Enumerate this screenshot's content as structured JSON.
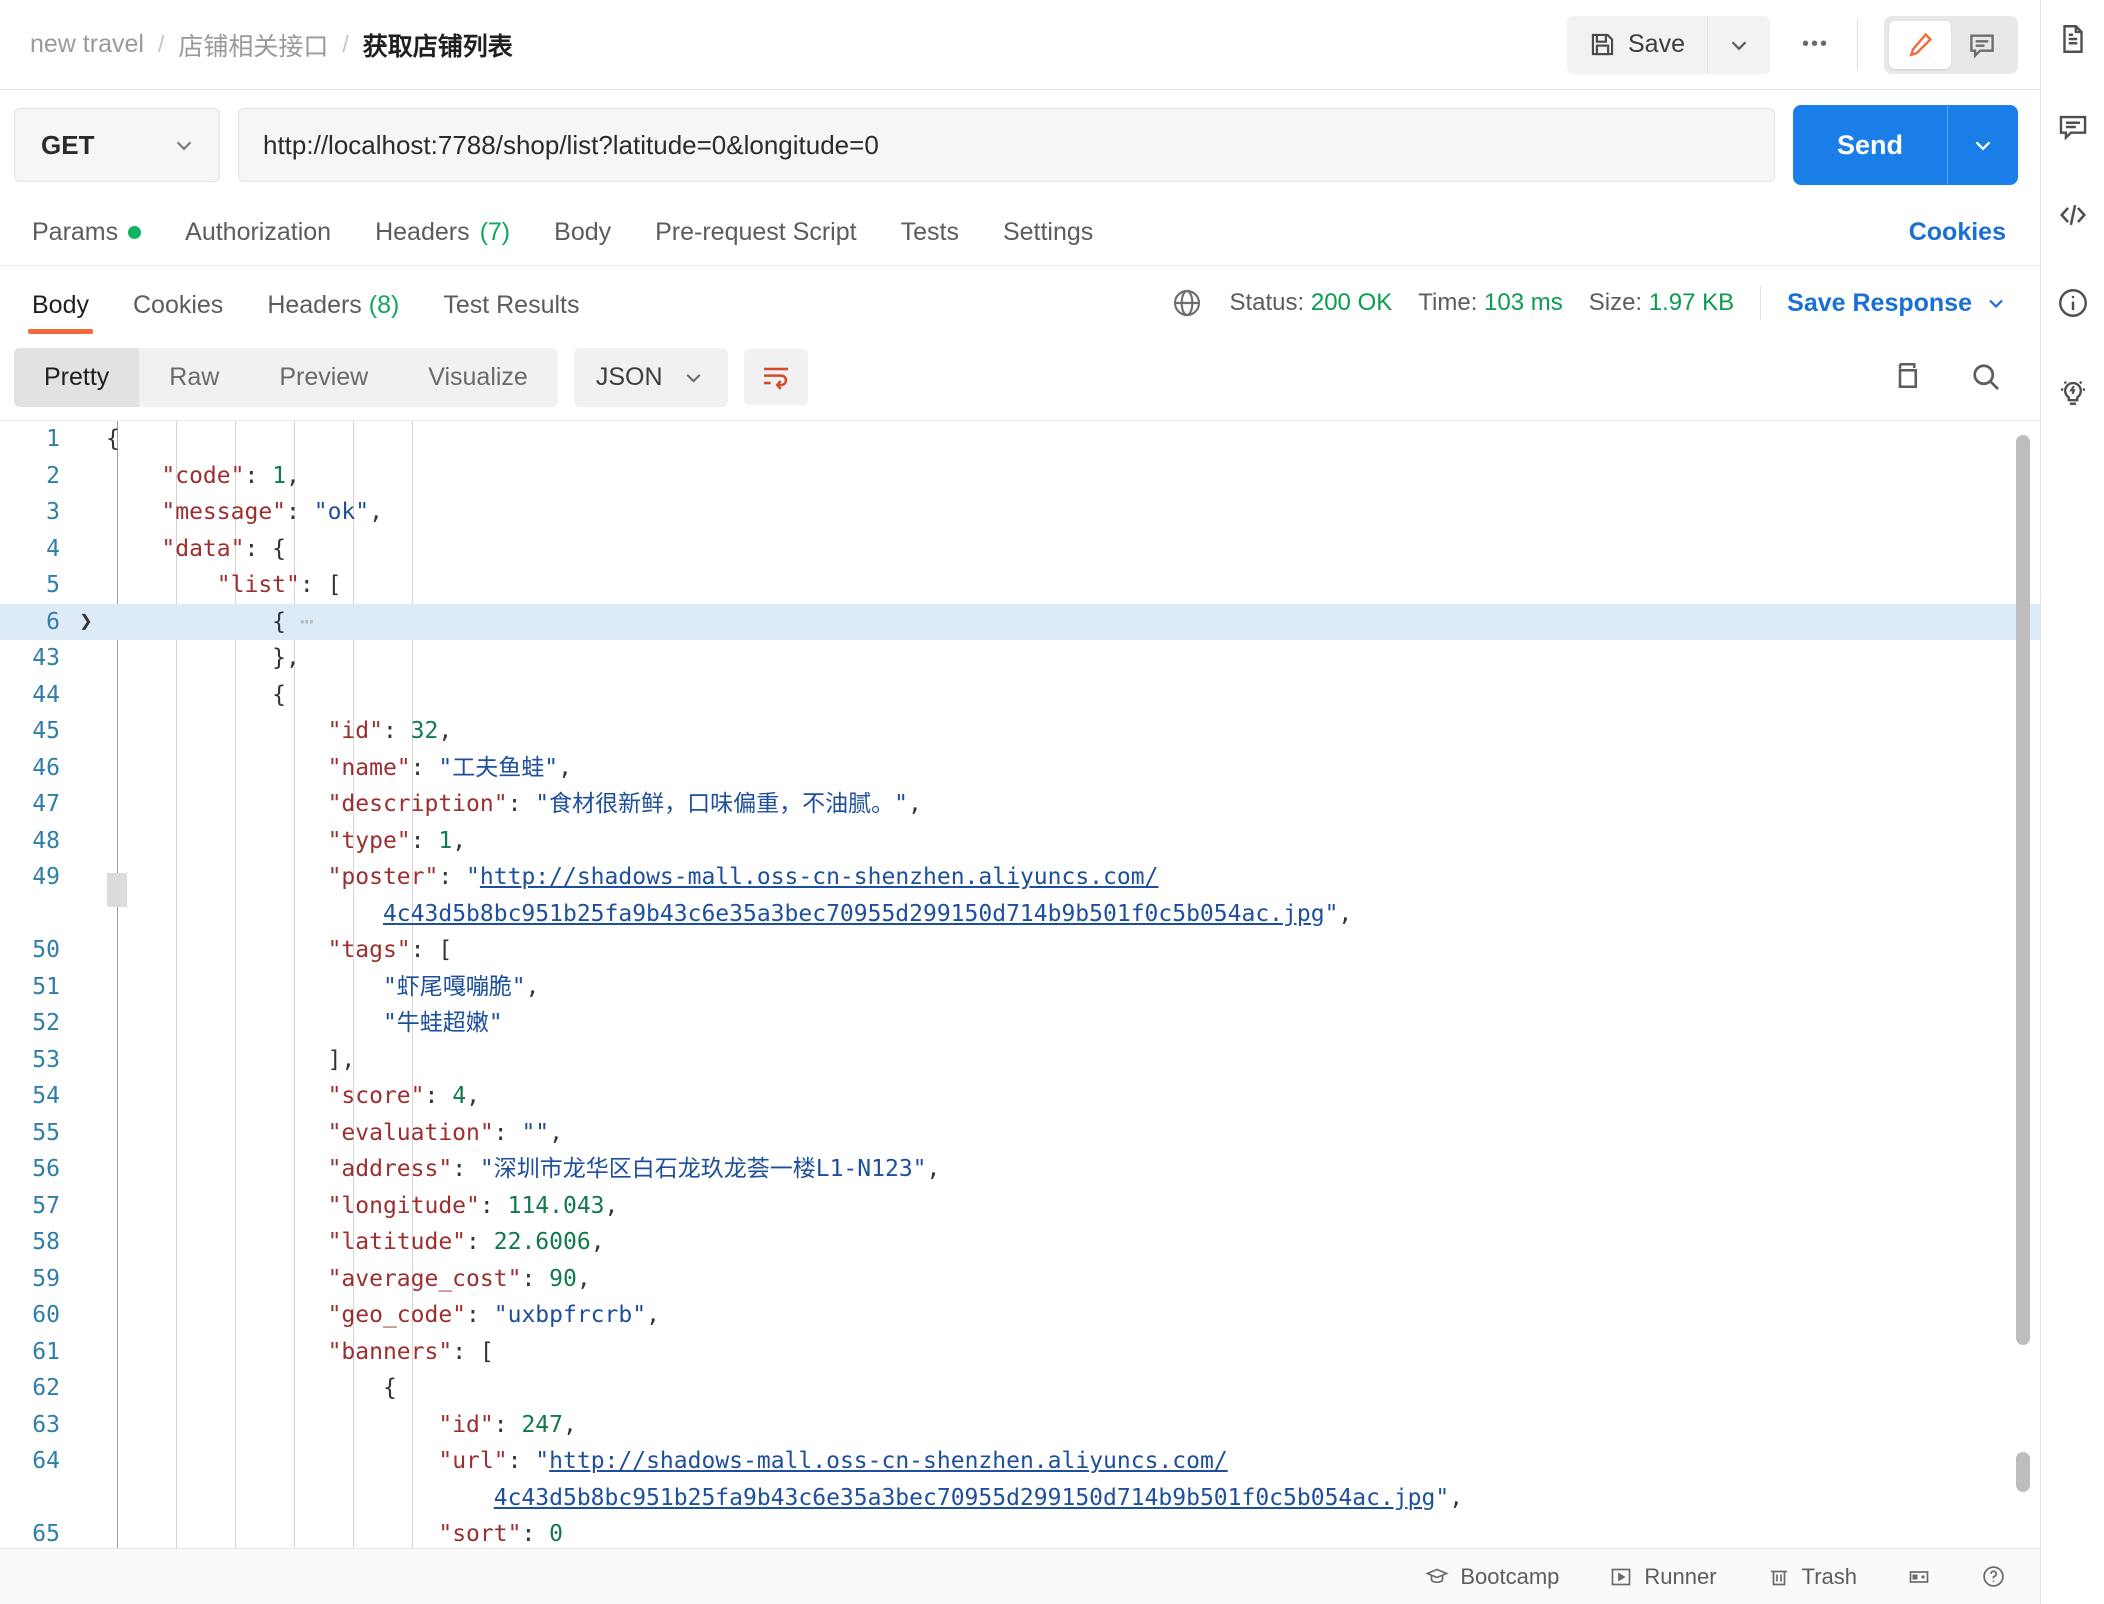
{
  "header": {
    "breadcrumb": [
      "new travel",
      "店铺相关接口",
      "获取店铺列表"
    ],
    "separator": "/",
    "save_label": "Save",
    "more_label": "•••",
    "icons": {
      "save": "floppy-disk-icon",
      "caret": "chevron-down-icon",
      "edit": "pencil-icon",
      "comment": "comment-icon"
    }
  },
  "request": {
    "method": "GET",
    "url": "http://localhost:7788/shop/list?latitude=0&longitude=0",
    "send_label": "Send",
    "tabs": [
      {
        "label": "Params",
        "badge": "",
        "dot": true
      },
      {
        "label": "Authorization",
        "badge": "",
        "dot": false
      },
      {
        "label": "Headers",
        "badge": "(7)",
        "dot": false
      },
      {
        "label": "Body",
        "badge": "",
        "dot": false
      },
      {
        "label": "Pre-request Script",
        "badge": "",
        "dot": false
      },
      {
        "label": "Tests",
        "badge": "",
        "dot": false
      },
      {
        "label": "Settings",
        "badge": "",
        "dot": false
      }
    ],
    "cookies_label": "Cookies"
  },
  "response": {
    "tabs": [
      {
        "label": "Body",
        "badge": "",
        "active": true
      },
      {
        "label": "Cookies",
        "badge": "",
        "active": false
      },
      {
        "label": "Headers",
        "badge": "(8)",
        "active": false
      },
      {
        "label": "Test Results",
        "badge": "",
        "active": false
      }
    ],
    "status_label": "Status:",
    "status_value": "200 OK",
    "time_label": "Time:",
    "time_value": "103 ms",
    "size_label": "Size:",
    "size_value": "1.97 KB",
    "save_response_label": "Save Response",
    "view_modes": [
      "Pretty",
      "Raw",
      "Preview",
      "Visualize"
    ],
    "active_view": "Pretty",
    "format": "JSON",
    "icons": {
      "globe": "globe-icon",
      "wrap": "word-wrap-icon",
      "copy": "copy-icon",
      "search": "search-icon"
    }
  },
  "code_lines": [
    {
      "num": "1",
      "indent": 0,
      "arrow": "",
      "tokens": [
        [
          "p",
          "{"
        ]
      ]
    },
    {
      "num": "2",
      "indent": 1,
      "arrow": "",
      "tokens": [
        [
          "k",
          "\"code\""
        ],
        [
          "p",
          ": "
        ],
        [
          "n",
          "1"
        ],
        [
          "p",
          ","
        ]
      ]
    },
    {
      "num": "3",
      "indent": 1,
      "arrow": "",
      "tokens": [
        [
          "k",
          "\"message\""
        ],
        [
          "p",
          ": "
        ],
        [
          "s",
          "\"ok\""
        ],
        [
          "p",
          ","
        ]
      ]
    },
    {
      "num": "4",
      "indent": 1,
      "arrow": "",
      "tokens": [
        [
          "k",
          "\"data\""
        ],
        [
          "p",
          ": {"
        ]
      ]
    },
    {
      "num": "5",
      "indent": 2,
      "arrow": "",
      "tokens": [
        [
          "k",
          "\"list\""
        ],
        [
          "p",
          ": ["
        ]
      ]
    },
    {
      "num": "6",
      "indent": 3,
      "arrow": "❯",
      "hl": true,
      "tokens": [
        [
          "p",
          "{ "
        ],
        [
          "g",
          "⋯"
        ]
      ]
    },
    {
      "num": "43",
      "indent": 3,
      "arrow": "",
      "tokens": [
        [
          "p",
          "},"
        ]
      ]
    },
    {
      "num": "44",
      "indent": 3,
      "arrow": "",
      "tokens": [
        [
          "p",
          "{"
        ]
      ]
    },
    {
      "num": "45",
      "indent": 4,
      "arrow": "",
      "tokens": [
        [
          "k",
          "\"id\""
        ],
        [
          "p",
          ": "
        ],
        [
          "n",
          "32"
        ],
        [
          "p",
          ","
        ]
      ]
    },
    {
      "num": "46",
      "indent": 4,
      "arrow": "",
      "tokens": [
        [
          "k",
          "\"name\""
        ],
        [
          "p",
          ": "
        ],
        [
          "s",
          "\"工夫鱼蛙\""
        ],
        [
          "p",
          ","
        ]
      ]
    },
    {
      "num": "47",
      "indent": 4,
      "arrow": "",
      "tokens": [
        [
          "k",
          "\"description\""
        ],
        [
          "p",
          ": "
        ],
        [
          "s",
          "\"食材很新鲜，口味偏重，不油腻。\""
        ],
        [
          "p",
          ","
        ]
      ]
    },
    {
      "num": "48",
      "indent": 4,
      "arrow": "",
      "tokens": [
        [
          "k",
          "\"type\""
        ],
        [
          "p",
          ": "
        ],
        [
          "n",
          "1"
        ],
        [
          "p",
          ","
        ]
      ]
    },
    {
      "num": "49",
      "indent": 4,
      "arrow": "",
      "tall": true,
      "tokens": [
        [
          "k",
          "\"poster\""
        ],
        [
          "p",
          ": "
        ],
        [
          "s",
          "\""
        ],
        [
          "u",
          "http://shadows-mall.oss-cn-shenzhen.aliyuncs.com/"
        ]
      ],
      "tokens2": [
        [
          "u",
          "4c43d5b8bc951b25fa9b43c6e35a3bec70955d299150d714b9b501f0c5b054ac.jpg"
        ],
        [
          "s",
          "\""
        ],
        [
          "p",
          ","
        ]
      ]
    },
    {
      "num": "50",
      "indent": 4,
      "arrow": "",
      "tokens": [
        [
          "k",
          "\"tags\""
        ],
        [
          "p",
          ": ["
        ]
      ]
    },
    {
      "num": "51",
      "indent": 5,
      "arrow": "",
      "tokens": [
        [
          "s",
          "\"虾尾嘎嘣脆\""
        ],
        [
          "p",
          ","
        ]
      ]
    },
    {
      "num": "52",
      "indent": 5,
      "arrow": "",
      "tokens": [
        [
          "s",
          "\"牛蛙超嫩\""
        ]
      ]
    },
    {
      "num": "53",
      "indent": 4,
      "arrow": "",
      "tokens": [
        [
          "p",
          "],"
        ]
      ]
    },
    {
      "num": "54",
      "indent": 4,
      "arrow": "",
      "tokens": [
        [
          "k",
          "\"score\""
        ],
        [
          "p",
          ": "
        ],
        [
          "n",
          "4"
        ],
        [
          "p",
          ","
        ]
      ]
    },
    {
      "num": "55",
      "indent": 4,
      "arrow": "",
      "tokens": [
        [
          "k",
          "\"evaluation\""
        ],
        [
          "p",
          ": "
        ],
        [
          "s",
          "\"\""
        ],
        [
          "p",
          ","
        ]
      ]
    },
    {
      "num": "56",
      "indent": 4,
      "arrow": "",
      "tokens": [
        [
          "k",
          "\"address\""
        ],
        [
          "p",
          ": "
        ],
        [
          "s",
          "\"深圳市龙华区白石龙玖龙荟一楼L1-N123\""
        ],
        [
          "p",
          ","
        ]
      ]
    },
    {
      "num": "57",
      "indent": 4,
      "arrow": "",
      "tokens": [
        [
          "k",
          "\"longitude\""
        ],
        [
          "p",
          ": "
        ],
        [
          "n",
          "114.043"
        ],
        [
          "p",
          ","
        ]
      ]
    },
    {
      "num": "58",
      "indent": 4,
      "arrow": "",
      "tokens": [
        [
          "k",
          "\"latitude\""
        ],
        [
          "p",
          ": "
        ],
        [
          "n",
          "22.6006"
        ],
        [
          "p",
          ","
        ]
      ]
    },
    {
      "num": "59",
      "indent": 4,
      "arrow": "",
      "tokens": [
        [
          "k",
          "\"average_cost\""
        ],
        [
          "p",
          ": "
        ],
        [
          "n",
          "90"
        ],
        [
          "p",
          ","
        ]
      ]
    },
    {
      "num": "60",
      "indent": 4,
      "arrow": "",
      "tokens": [
        [
          "k",
          "\"geo_code\""
        ],
        [
          "p",
          ": "
        ],
        [
          "s",
          "\"uxbpfrcrb\""
        ],
        [
          "p",
          ","
        ]
      ]
    },
    {
      "num": "61",
      "indent": 4,
      "arrow": "",
      "tokens": [
        [
          "k",
          "\"banners\""
        ],
        [
          "p",
          ": ["
        ]
      ]
    },
    {
      "num": "62",
      "indent": 5,
      "arrow": "",
      "tokens": [
        [
          "p",
          "{"
        ]
      ]
    },
    {
      "num": "63",
      "indent": 6,
      "arrow": "",
      "tokens": [
        [
          "k",
          "\"id\""
        ],
        [
          "p",
          ": "
        ],
        [
          "n",
          "247"
        ],
        [
          "p",
          ","
        ]
      ]
    },
    {
      "num": "64",
      "indent": 6,
      "arrow": "",
      "tall": true,
      "tokens": [
        [
          "k",
          "\"url\""
        ],
        [
          "p",
          ": "
        ],
        [
          "s",
          "\""
        ],
        [
          "u",
          "http://shadows-mall.oss-cn-shenzhen.aliyuncs.com/"
        ]
      ],
      "tokens2": [
        [
          "u",
          "4c43d5b8bc951b25fa9b43c6e35a3bec70955d299150d714b9b501f0c5b054ac.jpg"
        ],
        [
          "s",
          "\""
        ],
        [
          "p",
          ","
        ]
      ]
    },
    {
      "num": "65",
      "indent": 6,
      "arrow": "",
      "tokens": [
        [
          "k",
          "\"sort\""
        ],
        [
          "p",
          ": "
        ],
        [
          "n",
          "0"
        ]
      ]
    }
  ],
  "footer": {
    "items": [
      {
        "label": "Bootcamp",
        "icon": "graduation-cap-icon"
      },
      {
        "label": "Runner",
        "icon": "play-box-icon"
      },
      {
        "label": "Trash",
        "icon": "trash-icon"
      }
    ],
    "layout_icon": "layout-toggle-icon",
    "help_icon": "help-icon"
  },
  "rail": {
    "items": [
      {
        "icon": "document-icon"
      },
      {
        "icon": "comment-icon"
      },
      {
        "icon": "code-icon"
      },
      {
        "icon": "info-icon"
      },
      {
        "icon": "lightbulb-icon"
      }
    ]
  },
  "colors": {
    "accent": "#f26b3a",
    "send": "#1a7ee8",
    "link": "#1a6fd4",
    "ok": "#0a9b4e"
  }
}
